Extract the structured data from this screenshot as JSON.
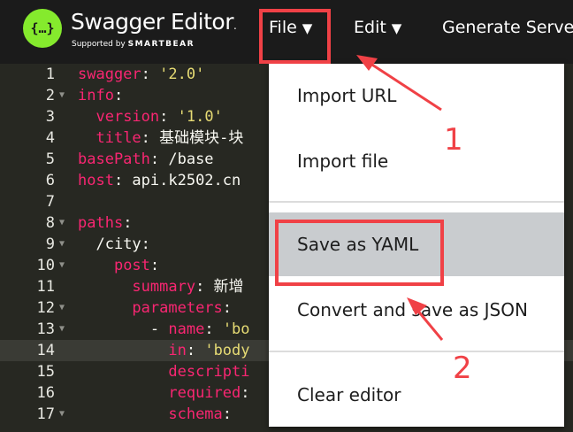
{
  "app": {
    "logo_glyph": "{…}",
    "title": "Swagger Editor",
    "title_mark": ".",
    "supported_by": "Supported by",
    "vendor": "SMARTBEAR",
    "brand_color": "#85ea2d"
  },
  "menubar": {
    "file": "File",
    "edit": "Edit",
    "generate": "Generate Serve",
    "caret": "▼"
  },
  "editor": {
    "lines": [
      {
        "n": "1",
        "fold": "",
        "html": "<span class=\"k\">swagger</span><span class=\"p\">: </span><span class=\"s\">'2.0'</span>"
      },
      {
        "n": "2",
        "fold": "▼",
        "html": "<span class=\"k\">info</span><span class=\"p\">:</span>"
      },
      {
        "n": "3",
        "fold": "",
        "html": "  <span class=\"k\">version</span><span class=\"p\">: </span><span class=\"s\">'1.0'</span>"
      },
      {
        "n": "4",
        "fold": "",
        "html": "  <span class=\"k\">title</span><span class=\"p\">: 基础模块-块</span>"
      },
      {
        "n": "5",
        "fold": "",
        "html": "<span class=\"k\">basePath</span><span class=\"p\">: /base</span>"
      },
      {
        "n": "6",
        "fold": "",
        "html": "<span class=\"k\">host</span><span class=\"p\">: api.k2502.cn</span>"
      },
      {
        "n": "7",
        "fold": "",
        "html": ""
      },
      {
        "n": "8",
        "fold": "▼",
        "html": "<span class=\"k\">paths</span><span class=\"p\">:</span>"
      },
      {
        "n": "9",
        "fold": "▼",
        "html": "  <span class=\"p\">/city:</span>"
      },
      {
        "n": "10",
        "fold": "▼",
        "html": "    <span class=\"k\">post</span><span class=\"p\">:</span>"
      },
      {
        "n": "11",
        "fold": "",
        "html": "      <span class=\"k\">summary</span><span class=\"p\">: 新增</span>"
      },
      {
        "n": "12",
        "fold": "▼",
        "html": "      <span class=\"k\">parameters</span><span class=\"p\">:</span>"
      },
      {
        "n": "13",
        "fold": "▼",
        "html": "        <span class=\"p\">- </span><span class=\"k\">name</span><span class=\"p\">: </span><span class=\"s\">'bo</span>"
      },
      {
        "n": "14",
        "fold": "",
        "html": "          <span class=\"k\">in</span><span class=\"p\">: </span><span class=\"s\">'body</span>"
      },
      {
        "n": "15",
        "fold": "",
        "html": "          <span class=\"k\">descripti</span>"
      },
      {
        "n": "16",
        "fold": "",
        "html": "          <span class=\"k\">required</span><span class=\"p\">:</span>"
      },
      {
        "n": "17",
        "fold": "▼",
        "html": "          <span class=\"k\">schema</span><span class=\"p\">:</span>"
      }
    ],
    "active_line": 14
  },
  "file_menu": {
    "import_url": "Import URL",
    "import_file": "Import file",
    "save_yaml": "Save as YAML",
    "convert_json": "Convert and save as JSON",
    "clear_editor": "Clear editor"
  },
  "annotations": {
    "step1": "1",
    "step2": "2",
    "color": "#f04146"
  }
}
